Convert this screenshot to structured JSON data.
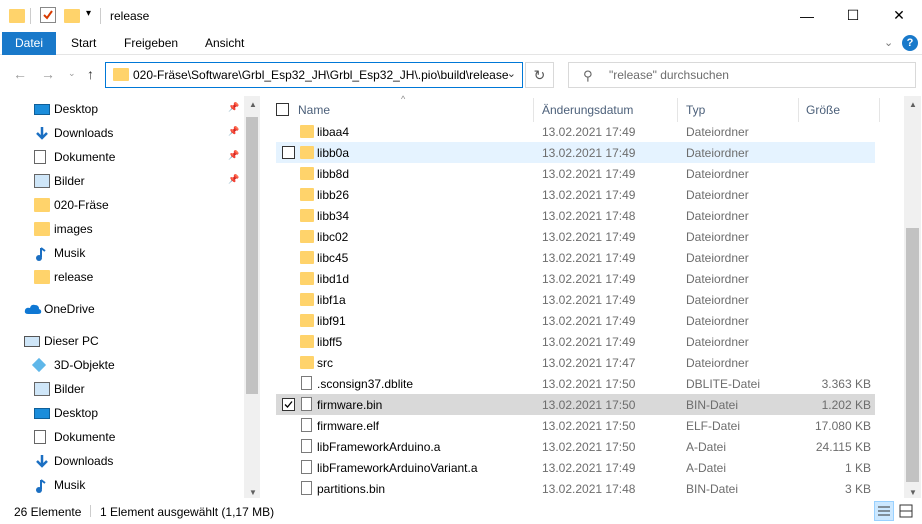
{
  "window": {
    "title": "release",
    "minimize_glyph": "—",
    "maximize_glyph": "☐",
    "close_glyph": "✕"
  },
  "ribbon": {
    "tabs": [
      "Datei",
      "Start",
      "Freigeben",
      "Ansicht"
    ],
    "expand_glyph": "⌄",
    "help_glyph": "?"
  },
  "address": {
    "path": "020-Fräse\\Software\\Grbl_Esp32_JH\\Grbl_Esp32_JH\\.pio\\build\\release",
    "search_placeholder": "\"release\" durchsuchen"
  },
  "nav": {
    "items": [
      {
        "label": "Desktop",
        "icon": "desktop-icon",
        "pinned": true
      },
      {
        "label": "Downloads",
        "icon": "download-icon",
        "pinned": true
      },
      {
        "label": "Dokumente",
        "icon": "document-icon",
        "pinned": true
      },
      {
        "label": "Bilder",
        "icon": "pictures-icon",
        "pinned": true
      },
      {
        "label": "020-Fräse",
        "icon": "folder-icon",
        "pinned": false
      },
      {
        "label": "images",
        "icon": "folder-icon",
        "pinned": false
      },
      {
        "label": "Musik",
        "icon": "music-icon",
        "pinned": false
      },
      {
        "label": "release",
        "icon": "folder-icon",
        "pinned": false
      },
      {
        "label": "OneDrive",
        "icon": "cloud-icon",
        "pinned": false
      },
      {
        "label": "Dieser PC",
        "icon": "computer-icon",
        "pinned": false
      },
      {
        "label": "3D-Objekte",
        "icon": "cube-icon",
        "pinned": false
      },
      {
        "label": "Bilder",
        "icon": "pictures-icon",
        "pinned": false
      },
      {
        "label": "Desktop",
        "icon": "desktop-icon",
        "pinned": false
      },
      {
        "label": "Dokumente",
        "icon": "document-icon",
        "pinned": false
      },
      {
        "label": "Downloads",
        "icon": "download-icon",
        "pinned": false
      },
      {
        "label": "Musik",
        "icon": "music-icon",
        "pinned": false
      }
    ]
  },
  "columns": {
    "name": "Name",
    "date": "Änderungsdatum",
    "type": "Typ",
    "size": "Größe"
  },
  "files": [
    {
      "name": "libaa4",
      "date": "13.02.2021 17:49",
      "type": "Dateiordner",
      "size": "",
      "kind": "folder"
    },
    {
      "name": "libb0a",
      "date": "13.02.2021 17:49",
      "type": "Dateiordner",
      "size": "",
      "kind": "folder"
    },
    {
      "name": "libb8d",
      "date": "13.02.2021 17:49",
      "type": "Dateiordner",
      "size": "",
      "kind": "folder"
    },
    {
      "name": "libb26",
      "date": "13.02.2021 17:49",
      "type": "Dateiordner",
      "size": "",
      "kind": "folder"
    },
    {
      "name": "libb34",
      "date": "13.02.2021 17:48",
      "type": "Dateiordner",
      "size": "",
      "kind": "folder"
    },
    {
      "name": "libc02",
      "date": "13.02.2021 17:49",
      "type": "Dateiordner",
      "size": "",
      "kind": "folder"
    },
    {
      "name": "libc45",
      "date": "13.02.2021 17:49",
      "type": "Dateiordner",
      "size": "",
      "kind": "folder"
    },
    {
      "name": "libd1d",
      "date": "13.02.2021 17:49",
      "type": "Dateiordner",
      "size": "",
      "kind": "folder"
    },
    {
      "name": "libf1a",
      "date": "13.02.2021 17:49",
      "type": "Dateiordner",
      "size": "",
      "kind": "folder"
    },
    {
      "name": "libf91",
      "date": "13.02.2021 17:49",
      "type": "Dateiordner",
      "size": "",
      "kind": "folder"
    },
    {
      "name": "libff5",
      "date": "13.02.2021 17:49",
      "type": "Dateiordner",
      "size": "",
      "kind": "folder"
    },
    {
      "name": "src",
      "date": "13.02.2021 17:47",
      "type": "Dateiordner",
      "size": "",
      "kind": "folder"
    },
    {
      "name": ".sconsign37.dblite",
      "date": "13.02.2021 17:50",
      "type": "DBLITE-Datei",
      "size": "3.363 KB",
      "kind": "file"
    },
    {
      "name": "firmware.bin",
      "date": "13.02.2021 17:50",
      "type": "BIN-Datei",
      "size": "1.202 KB",
      "kind": "file"
    },
    {
      "name": "firmware.elf",
      "date": "13.02.2021 17:50",
      "type": "ELF-Datei",
      "size": "17.080 KB",
      "kind": "file"
    },
    {
      "name": "libFrameworkArduino.a",
      "date": "13.02.2021 17:50",
      "type": "A-Datei",
      "size": "24.115 KB",
      "kind": "file"
    },
    {
      "name": "libFrameworkArduinoVariant.a",
      "date": "13.02.2021 17:49",
      "type": "A-Datei",
      "size": "1 KB",
      "kind": "file"
    },
    {
      "name": "partitions.bin",
      "date": "13.02.2021 17:48",
      "type": "BIN-Datei",
      "size": "3 KB",
      "kind": "file"
    }
  ],
  "selection": {
    "hover_index": 1,
    "selected_index": 13
  },
  "status": {
    "count": "26 Elemente",
    "selection": "1 Element ausgewählt (1,17 MB)"
  }
}
